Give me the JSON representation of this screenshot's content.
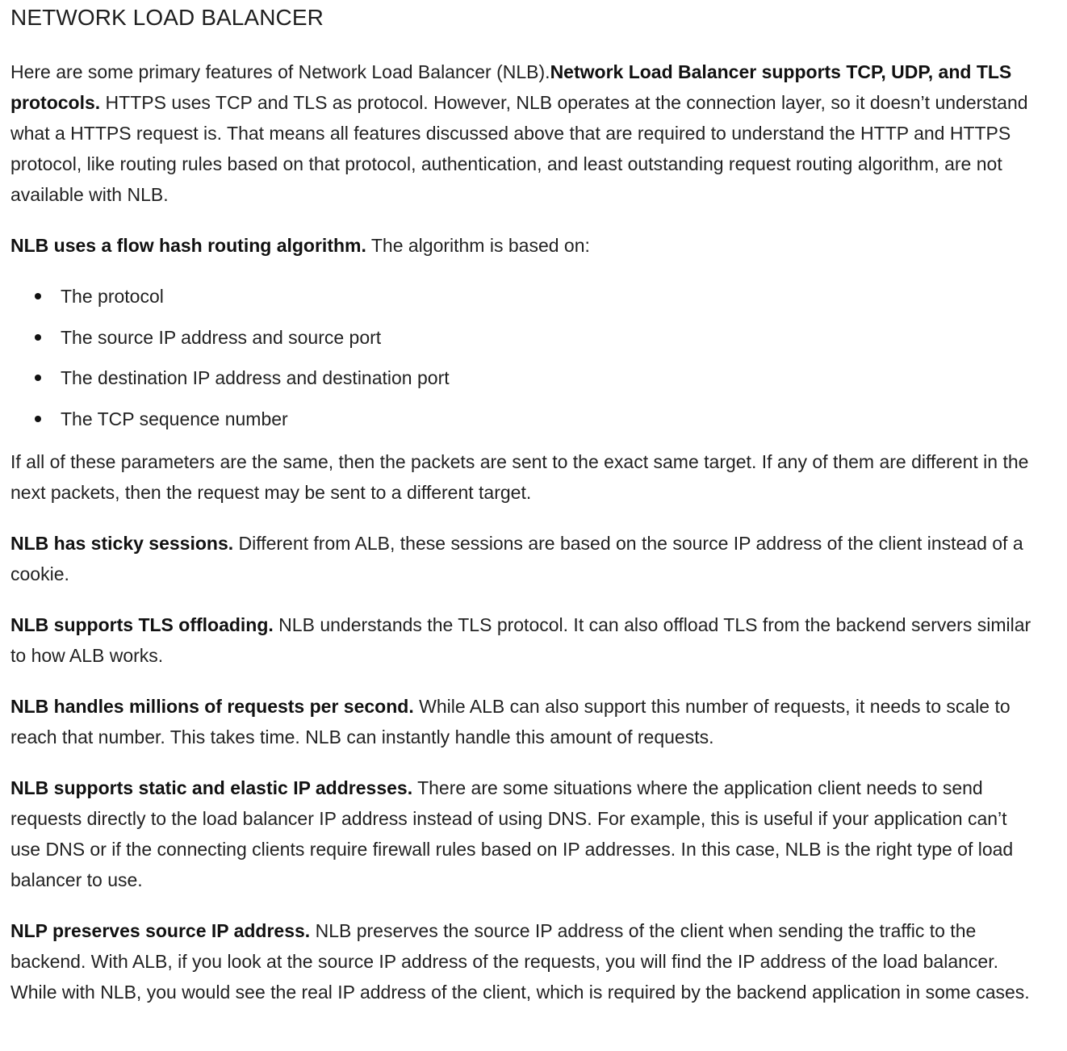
{
  "title": "NETWORK LOAD BALANCER",
  "intro": {
    "lead": "Here are some primary features of Network Load Balancer (NLB).",
    "bold": "Network Load Balancer supports TCP, UDP, and TLS protocols.",
    "text": " HTTPS uses TCP and TLS as protocol. However, NLB operates at the connection layer, so it doesn’t understand what a HTTPS request is. That means all features discussed above that are required to understand the HTTP and HTTPS protocol, like routing rules based on that protocol, authentication, and least outstanding request routing algorithm, are not available with NLB."
  },
  "flow_hash": {
    "bold": "NLB uses a flow hash routing algorithm.",
    "text": " The algorithm is based on:"
  },
  "bullets": [
    "The protocol",
    "The source IP address and source port",
    "The destination IP address and destination port",
    "The TCP sequence number"
  ],
  "same_params": "If all of these parameters are the same, then the packets are sent to the exact same target. If any of them are different in the next packets, then the request may be sent to a different target.",
  "sticky": {
    "bold": "NLB has sticky sessions.",
    "text": " Different from ALB, these sessions are based on the source IP address of the client instead of a cookie."
  },
  "tls": {
    "bold": "NLB supports TLS offloading.",
    "text": " NLB understands the TLS protocol. It can also offload TLS from the backend servers similar to how ALB works."
  },
  "millions": {
    "bold": "NLB handles millions of requests per second.",
    "text": " While ALB can also support this number of requests, it needs to scale to reach that number. This takes time. NLB can instantly handle this amount of requests."
  },
  "static_ip": {
    "bold": "NLB supports static and elastic IP addresses.",
    "text": " There are some situations where the application client needs to send requests directly to the load balancer IP address instead of using DNS. For example, this is useful if your application can’t use DNS or if the connecting clients require firewall rules based on IP addresses. In this case, NLB is the right type of load balancer to use."
  },
  "preserve_ip": {
    "bold": "NLP preserves source IP address.",
    "text": " NLB preserves the source IP address of the client when sending the traffic to the backend. With ALB, if you look at the source IP address of the requests, you will find the IP address of the load balancer. While with NLB, you would see the real IP address of the client, which is required by the backend application in some cases."
  }
}
